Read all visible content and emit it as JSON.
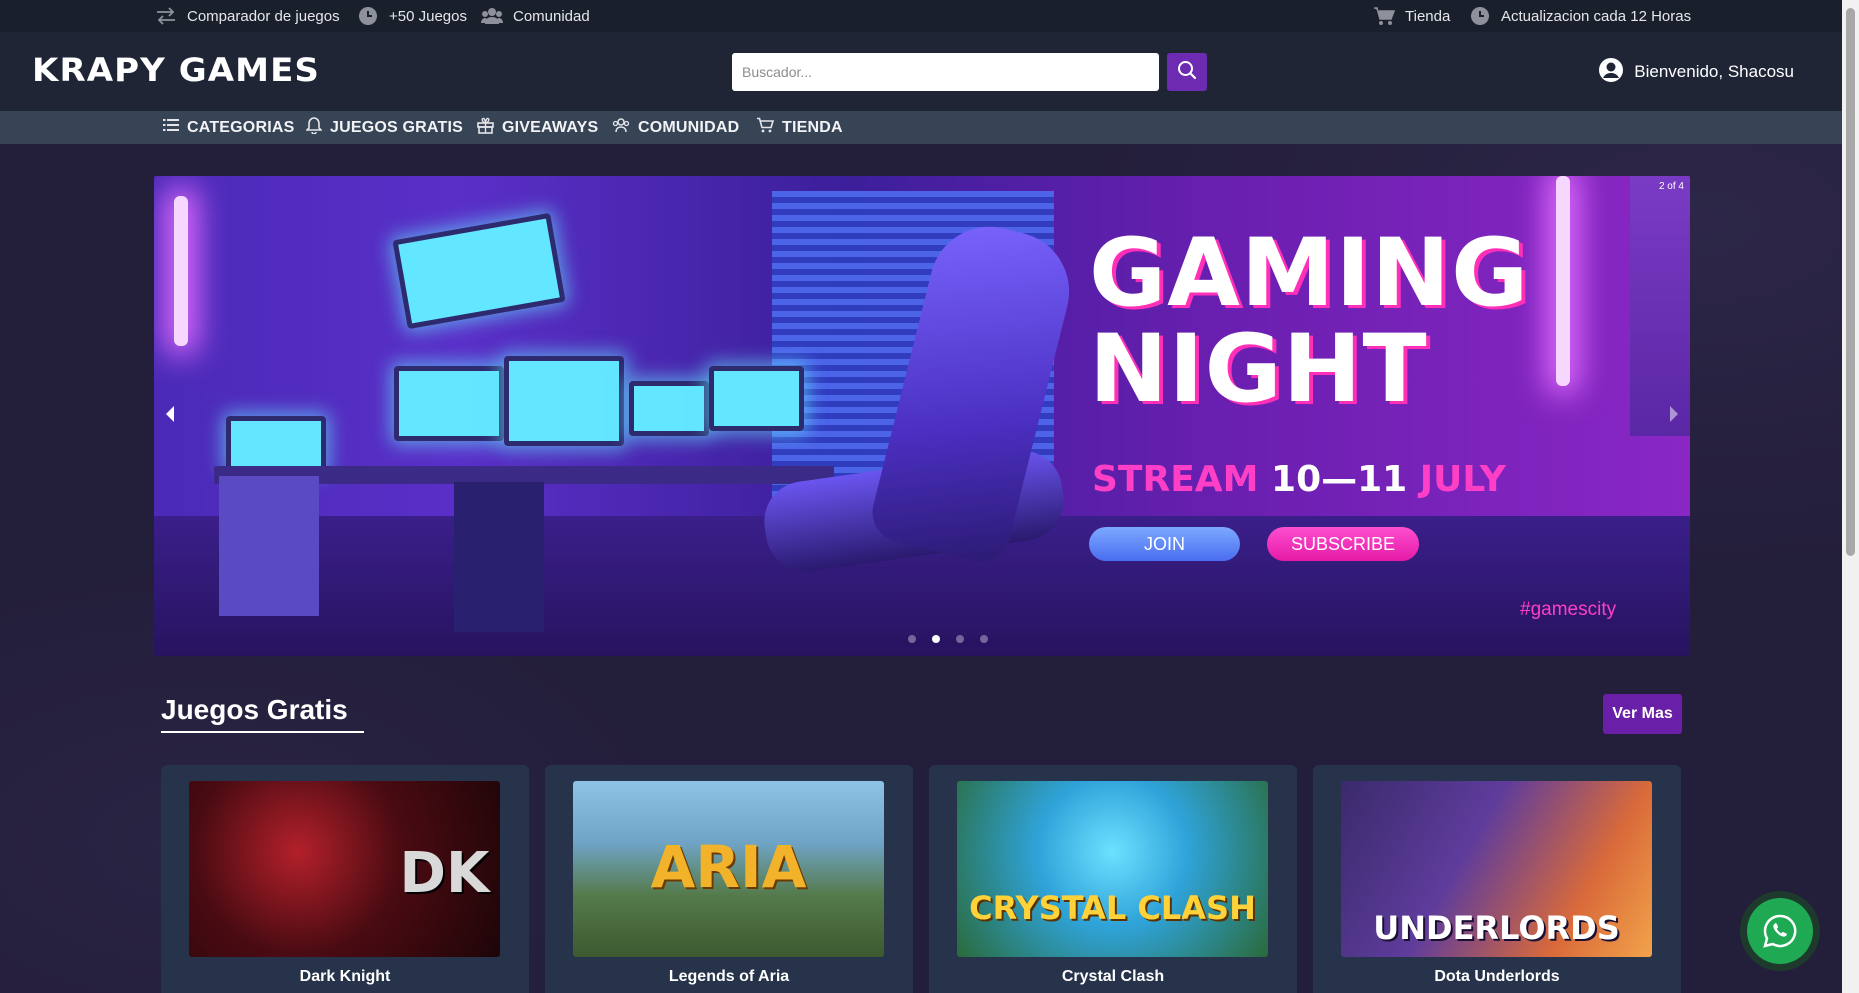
{
  "topbar": {
    "comparador": "Comparador de juegos",
    "juegos": "+50 Juegos",
    "comunidad": "Comunidad",
    "tienda": "Tienda",
    "actualizacion": "Actualizacion cada 12 Horas"
  },
  "header": {
    "logo": "KRAPY GAMES",
    "search_placeholder": "Buscador...",
    "welcome": "Bienvenido, Shacosu"
  },
  "nav": {
    "items": [
      {
        "label": "CATEGORIAS",
        "icon": "list-icon"
      },
      {
        "label": "JUEGOS GRATIS",
        "icon": "bell-icon"
      },
      {
        "label": "GIVEAWAYS",
        "icon": "gift-icon"
      },
      {
        "label": "COMUNIDAD",
        "icon": "people-icon"
      },
      {
        "label": "TIENDA",
        "icon": "cart-icon"
      }
    ]
  },
  "carousel": {
    "counter": "2 of 4",
    "slide_line1": "GAMING",
    "slide_line2": "NIGHT",
    "stream_word": "STREAM",
    "dates": "10—11",
    "month": "JULY",
    "join": "JOIN",
    "subscribe": "SUBSCRIBE",
    "hashtag": "#gamescity",
    "active_index": 2,
    "total": 4
  },
  "section": {
    "title": "Juegos Gratis",
    "more_button": "Ver Mas"
  },
  "games": [
    {
      "name": "Dark Knight",
      "art": "DK"
    },
    {
      "name": "Legends of Aria",
      "art": "ARIA"
    },
    {
      "name": "Crystal Clash",
      "art": "CRYSTAL CLASH"
    },
    {
      "name": "Dota Underlords",
      "art": "UNDERLORDS"
    }
  ],
  "colors": {
    "accent": "#6a1fa8",
    "topbar": "#1a1f2c",
    "nav": "#364456",
    "card": "#26334a",
    "whatsapp": "#1ea952"
  }
}
